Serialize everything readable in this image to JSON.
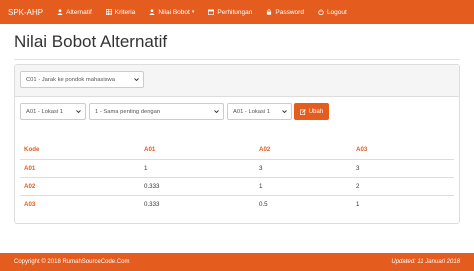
{
  "navbar": {
    "brand": "SPK-AHP",
    "items": [
      {
        "label": "Alternatif",
        "icon": "user-icon"
      },
      {
        "label": "Kriteria",
        "icon": "table-icon"
      },
      {
        "label": "Nilai Bobot",
        "icon": "user-icon"
      },
      {
        "label": "Perhitungan",
        "icon": "calendar-icon"
      },
      {
        "label": "Password",
        "icon": "lock-icon"
      },
      {
        "label": "Logout",
        "icon": "power-icon"
      }
    ]
  },
  "page": {
    "title": "Nilai Bobot Alternatif"
  },
  "filters": {
    "kriteria_selected": "C01 - Jarak ke pondok mahasiswa",
    "alt1_selected": "A01 - Lokasi 1",
    "nilai_selected": "1 - Sama penting dengan",
    "alt2_selected": "A01 - Lokasi 1",
    "ubah_label": "Ubah"
  },
  "table": {
    "headers": [
      "Kode",
      "A01",
      "A02",
      "A03"
    ],
    "rows": [
      [
        "A01",
        "1",
        "3",
        "3"
      ],
      [
        "A02",
        "0.333",
        "1",
        "2"
      ],
      [
        "A03",
        "0.333",
        "0.5",
        "1"
      ]
    ]
  },
  "footer": {
    "copyright": "Copyright © 2018 RumahSourceCode.Com",
    "updated": "Updated: 11 Januari 2018"
  },
  "colors": {
    "accent": "#e45c1e",
    "panel_head": "#f5f5f5"
  }
}
